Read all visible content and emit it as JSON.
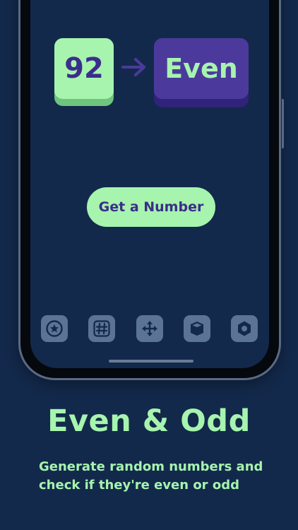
{
  "game": {
    "number": "92",
    "result": "Even",
    "button_label": "Get a Number"
  },
  "tabbar": {
    "items": [
      {
        "icon": "star-icon"
      },
      {
        "icon": "hash-icon"
      },
      {
        "icon": "move-arrows-icon"
      },
      {
        "icon": "cube-icon"
      },
      {
        "icon": "hexagon-icon"
      }
    ]
  },
  "marketing": {
    "headline": "Even & Odd",
    "subtitle_line1": "Generate random numbers and",
    "subtitle_line2": "check if they're even or odd"
  },
  "colors": {
    "background": "#13294b",
    "accent_green": "#a6f4ae",
    "accent_purple": "#4b3a9c",
    "tab_icon_bg": "#5b7394"
  }
}
